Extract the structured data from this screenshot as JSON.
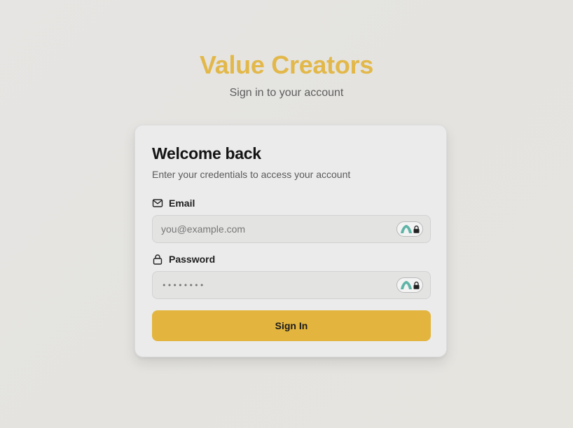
{
  "header": {
    "brand": "Value Creators",
    "subtitle": "Sign in to your account"
  },
  "card": {
    "title": "Welcome back",
    "description": "Enter your credentials to access your account"
  },
  "form": {
    "email": {
      "label": "Email",
      "placeholder": "you@example.com",
      "icon": "mail-icon"
    },
    "password": {
      "label": "Password",
      "masked_placeholder": "••••••••",
      "icon": "lock-icon"
    },
    "submit_label": "Sign In",
    "password_manager_icon": "password-manager-icon"
  },
  "colors": {
    "brand": "#e3b84a",
    "button": "#e3b53f",
    "badge_teal": "#5fb4a8"
  }
}
